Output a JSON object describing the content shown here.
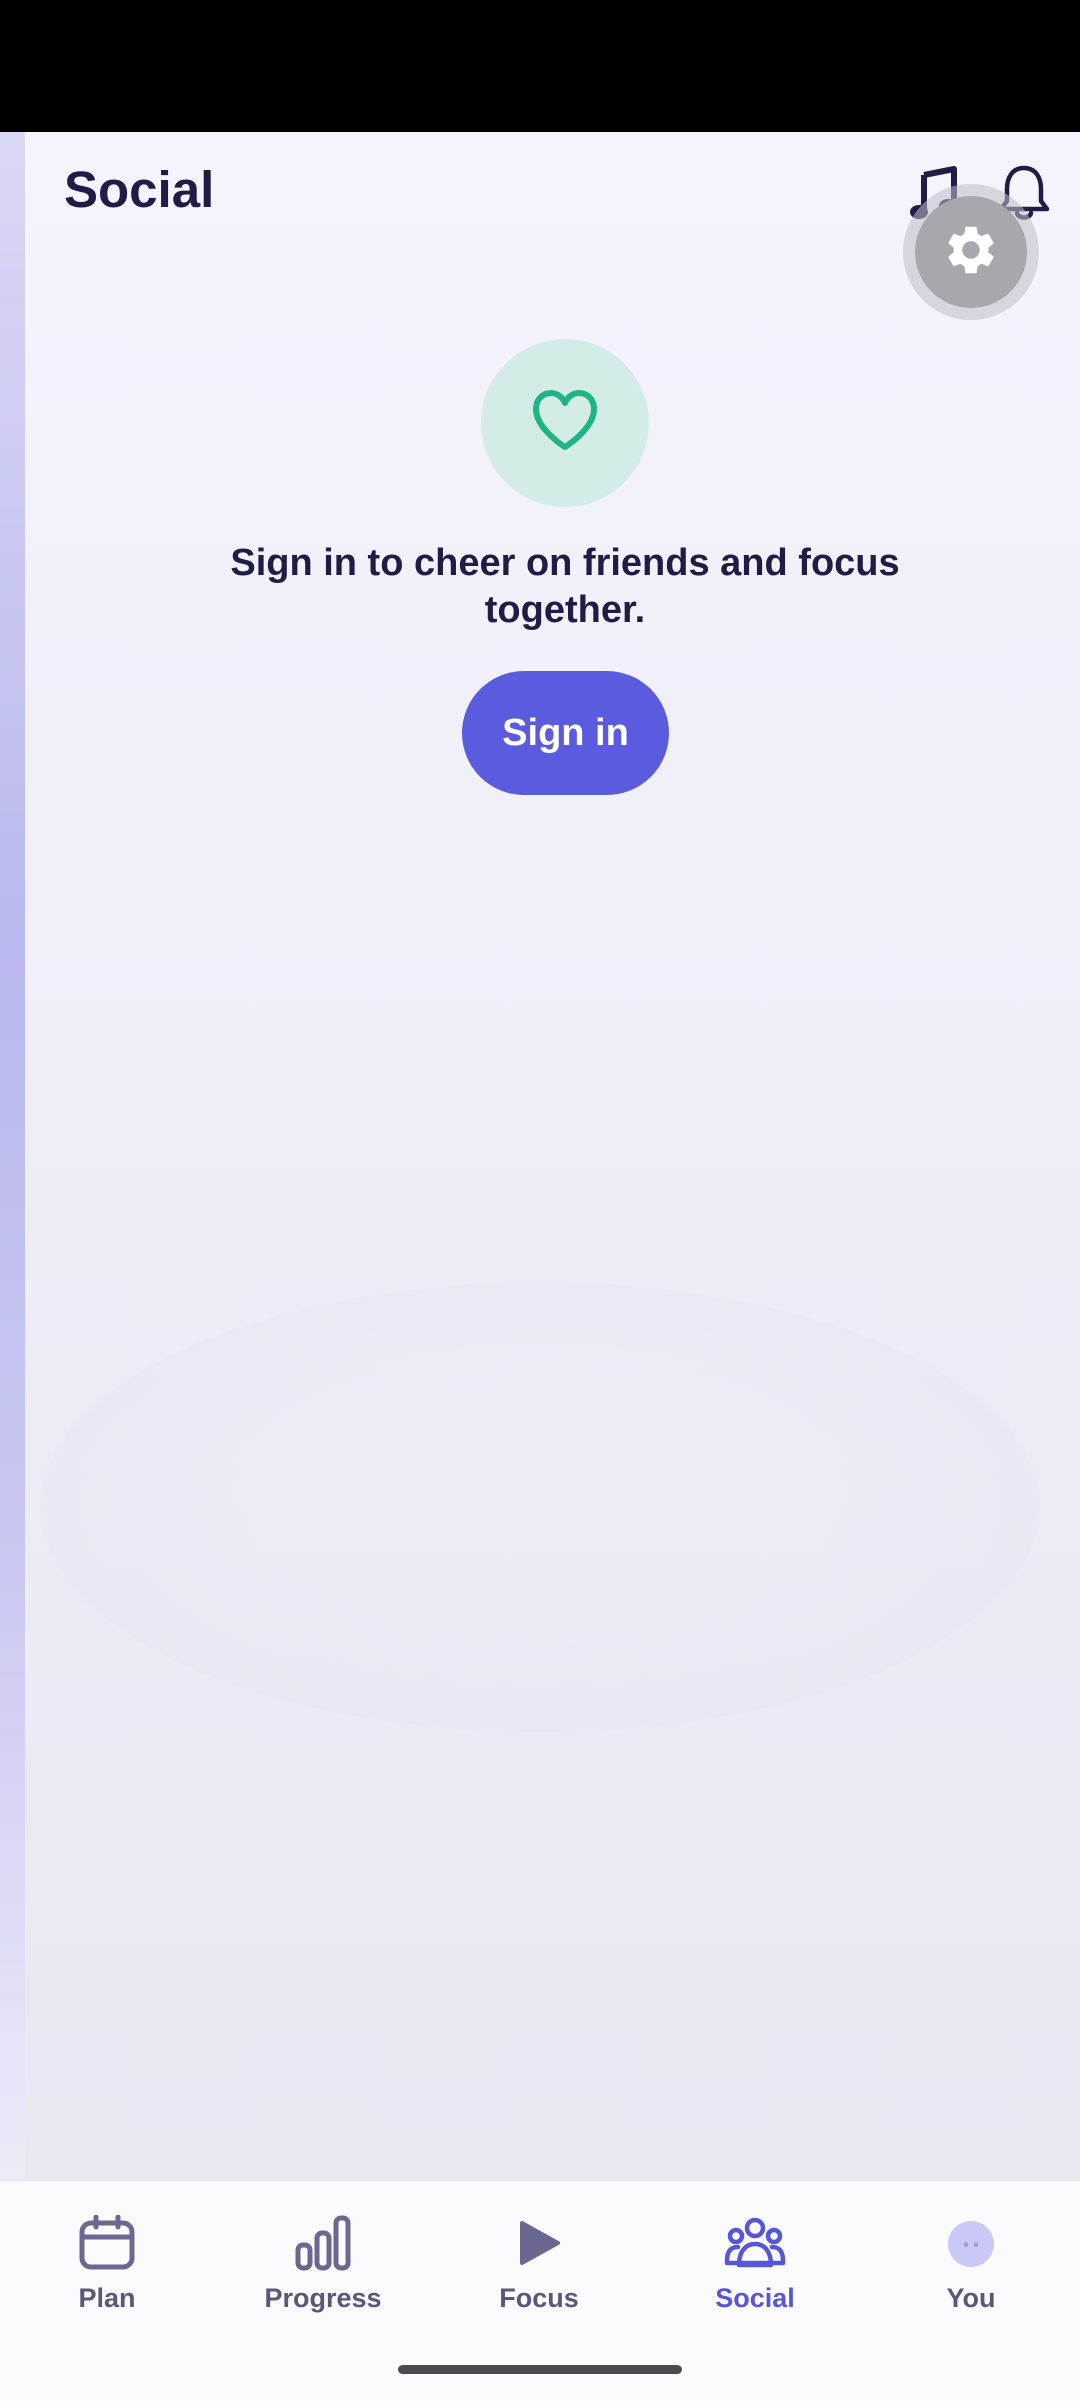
{
  "header": {
    "title": "Social"
  },
  "icons": {
    "music": "music-note-icon",
    "notifications": "bell-icon",
    "settings": "gear-icon",
    "hero": "heart-icon"
  },
  "empty_state": {
    "message": "Sign in to cheer on friends and focus together.",
    "button_label": "Sign in"
  },
  "nav": {
    "items": [
      {
        "label": "Plan",
        "icon": "calendar-icon",
        "active": false
      },
      {
        "label": "Progress",
        "icon": "bar-chart-icon",
        "active": false
      },
      {
        "label": "Focus",
        "icon": "play-icon",
        "active": false
      },
      {
        "label": "Social",
        "icon": "people-icon",
        "active": true
      },
      {
        "label": "You",
        "icon": "avatar-icon",
        "active": false
      }
    ]
  },
  "colors": {
    "accent": "#5b5bdf",
    "heart": "#1fb487",
    "heart_bg": "#d4ece8",
    "title_text": "#1f1d45"
  }
}
